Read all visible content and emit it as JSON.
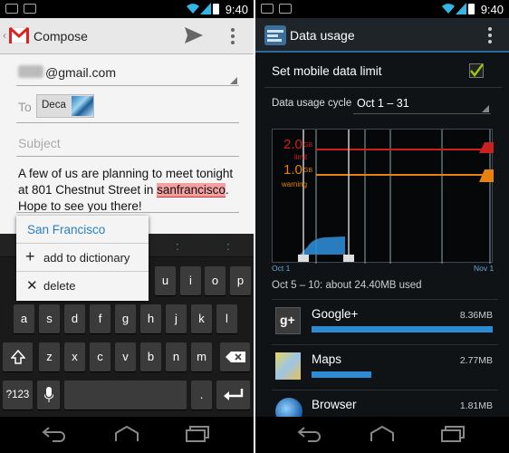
{
  "left": {
    "status": {
      "time": "9:40"
    },
    "actionbar": {
      "title": "Compose"
    },
    "from": "@gmail.com",
    "to_label": "To",
    "to_chip": "Deca",
    "subject_placeholder": "Subject",
    "message": {
      "part1": "A few of us are planning to meet tonight at 801 Chestnut Street in ",
      "misspelled": "sanfrancisco",
      "part2": ". Hope to see you there!"
    },
    "suggestion_popup": {
      "suggestion": "San Francisco",
      "add_to_dictionary": "add to dictionary",
      "delete": "delete"
    },
    "keyboard": {
      "row1": [
        "u",
        "i",
        "o",
        "p"
      ],
      "row2": [
        "a",
        "s",
        "d",
        "f",
        "g",
        "h",
        "j",
        "k",
        "l"
      ],
      "row3": [
        "z",
        "x",
        "c",
        "v",
        "b",
        "n",
        "m"
      ],
      "symbols_key": "?123",
      "period_key": "."
    }
  },
  "right": {
    "status": {
      "time": "9:40"
    },
    "actionbar": {
      "title": "Data usage"
    },
    "set_limit_label": "Set mobile data limit",
    "set_limit_checked": true,
    "cycle_label": "Data usage cycle",
    "cycle_value": "Oct 1 – 31",
    "chart": {
      "limit_value": "2.0",
      "limit_unit": "GB",
      "limit_label": "limit",
      "warning_value": "1.0",
      "warning_unit": "GB",
      "warning_label": "warning",
      "x_start": "Oct 1",
      "x_end": "Nov 1",
      "colors": {
        "limit": "#cc1f1f",
        "warning": "#e8820c",
        "usage": "#2d8bd4"
      }
    },
    "usage_summary": "Oct 5 – 10: about 24.40MB used",
    "apps": [
      {
        "name": "Google+",
        "usage": "8.36MB",
        "fraction": 1.0,
        "icon": "google-plus-icon"
      },
      {
        "name": "Maps",
        "usage": "2.77MB",
        "fraction": 0.33,
        "icon": "maps-icon"
      },
      {
        "name": "Browser",
        "usage": "1.81MB",
        "fraction": 0.22,
        "icon": "browser-icon"
      }
    ]
  }
}
